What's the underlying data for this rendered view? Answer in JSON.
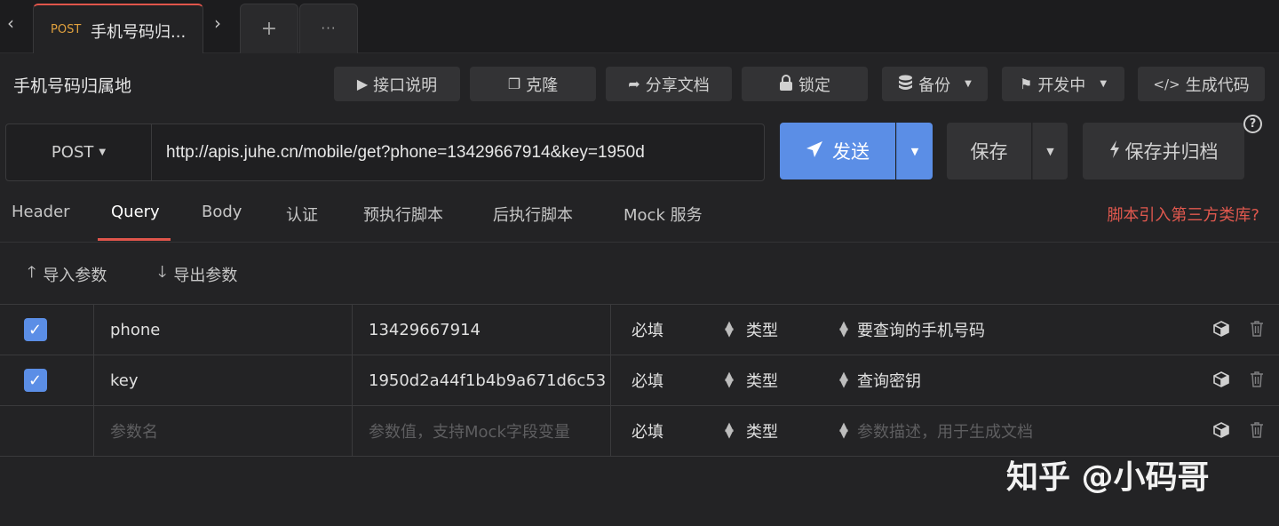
{
  "tabs": [
    {
      "method": "POST",
      "title": "手机号码归..."
    }
  ],
  "tab_controls": {
    "prev": "‹",
    "next": "›",
    "add": "+",
    "more": "···"
  },
  "page_title": "手机号码归属地",
  "toolbar": {
    "doc": "接口说明",
    "clone": "克隆",
    "share": "分享文档",
    "lock": "锁定",
    "backup": "备份",
    "status": "开发中",
    "gencode": "生成代码"
  },
  "request": {
    "method": "POST",
    "url": "http://apis.juhe.cn/mobile/get?phone=13429667914&key=1950d",
    "send": "发送",
    "save": "保存",
    "save_archive": "保存并归档"
  },
  "subtabs": [
    "Header",
    "Query",
    "Body",
    "认证",
    "预执行脚本",
    "后执行脚本",
    "Mock 服务"
  ],
  "active_subtab": "Query",
  "script_link": "脚本引入第三方类库?",
  "param_actions": {
    "import": "导入参数",
    "export": "导出参数"
  },
  "params": [
    {
      "checked": true,
      "name": "phone",
      "value": "13429667914",
      "required": "必填",
      "type": "类型",
      "desc": "要查询的手机号码"
    },
    {
      "checked": true,
      "name": "key",
      "value": "1950d2a44f1b4b9a671d6c53",
      "required": "必填",
      "type": "类型",
      "desc": "查询密钥"
    }
  ],
  "new_param": {
    "name_placeholder": "参数名",
    "value_placeholder": "参数值，支持Mock字段变量",
    "required": "必填",
    "type": "类型",
    "desc_placeholder": "参数描述，用于生成文档"
  },
  "watermark": "知乎 @小码哥",
  "colors": {
    "accent_blue": "#5b8ee6",
    "accent_red": "#e0554b",
    "method_orange": "#e0a13e"
  }
}
